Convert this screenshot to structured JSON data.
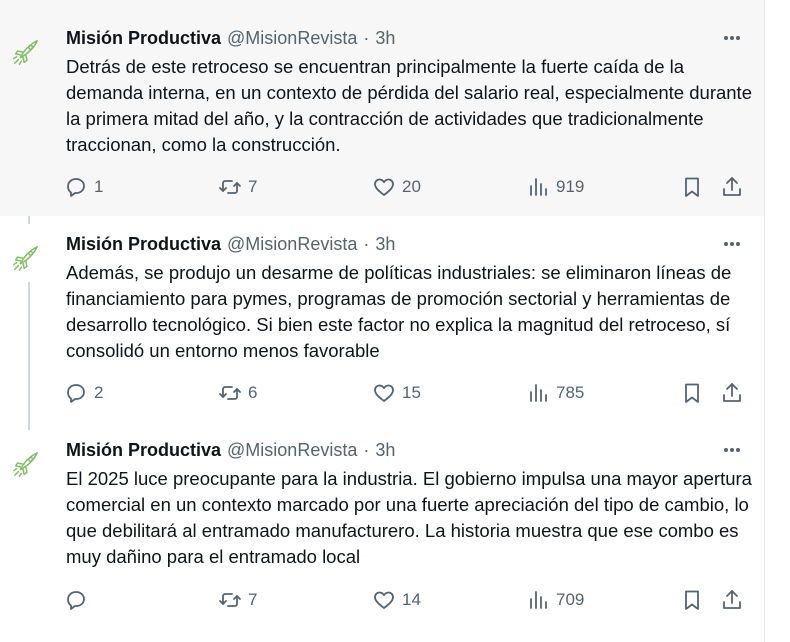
{
  "tweets": [
    {
      "name": "Misión Productiva",
      "handle": "@MisionRevista",
      "dot": "·",
      "time": "3h",
      "text": "Detrás de este retroceso se encuentran principalmente la fuerte caída de la demanda interna, en un contexto de pérdida del salario real, especialmente durante la primera mitad del año, y la contracción de actividades que tradicionalmente traccionan, como la construcción.",
      "replies": "1",
      "reposts": "7",
      "likes": "20",
      "views": "919"
    },
    {
      "name": "Misión Productiva",
      "handle": "@MisionRevista",
      "dot": "·",
      "time": "3h",
      "text": "Además, se produjo un desarme de políticas industriales: se eliminaron líneas de financiamiento para pymes, programas de promoción sectorial y herramientas de desarrollo tecnológico. Si bien este factor no explica la magnitud del retroceso, sí consolidó un entorno menos favorable",
      "replies": "2",
      "reposts": "6",
      "likes": "15",
      "views": "785"
    },
    {
      "name": "Misión Productiva",
      "handle": "@MisionRevista",
      "dot": "·",
      "time": "3h",
      "text": "El 2025 luce preocupante para la industria. El gobierno impulsa una mayor apertura comercial en un contexto marcado por una fuerte apreciación del tipo de cambio, lo que debilitará al entramado manufacturero. La historia muestra que ese combo es muy dañino para el entramado local",
      "replies": "",
      "reposts": "7",
      "likes": "14",
      "views": "709"
    }
  ],
  "icons": {
    "avatar": "rocket-icon",
    "more": "more-icon",
    "reply": "reply-icon",
    "repost": "repost-icon",
    "like": "like-icon",
    "views": "views-icon",
    "bookmark": "bookmark-icon",
    "share": "share-icon"
  },
  "colors": {
    "highlight_bg": "#f7f7f7",
    "secondary_text": "#536471",
    "avatar_green": "#7fbf5f"
  }
}
